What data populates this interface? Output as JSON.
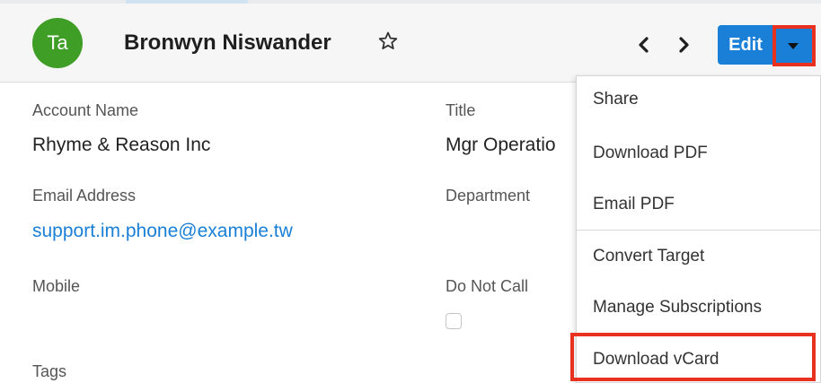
{
  "record": {
    "avatar_initials": "Ta",
    "name": "Bronwyn Niswander"
  },
  "header": {
    "favorite_icon": "star-outline-icon",
    "prev_icon": "chevron-left-icon",
    "next_icon": "chevron-right-icon",
    "edit_label": "Edit",
    "actions_icon": "caret-down-icon"
  },
  "fields": {
    "account_name": {
      "label": "Account Name",
      "value": "Rhyme & Reason Inc"
    },
    "title": {
      "label": "Title",
      "value": "Mgr Operatio"
    },
    "email": {
      "label": "Email Address",
      "value": "support.im.phone@example.tw"
    },
    "department": {
      "label": "Department",
      "value": ""
    },
    "mobile": {
      "label": "Mobile",
      "value": ""
    },
    "do_not_call": {
      "label": "Do Not Call",
      "checked": false
    },
    "tags": {
      "label": "Tags"
    }
  },
  "actions_menu": {
    "items": [
      {
        "label": "Share"
      },
      {
        "label": "Download PDF"
      },
      {
        "label": "Email PDF"
      },
      {
        "label": "Convert Target"
      },
      {
        "label": "Manage Subscriptions"
      },
      {
        "label": "Download vCard"
      }
    ]
  },
  "colors": {
    "avatar": "#3f9e25",
    "primary_button": "#1a7fd6",
    "link": "#1a7fd6",
    "highlight": "#e8321f"
  }
}
